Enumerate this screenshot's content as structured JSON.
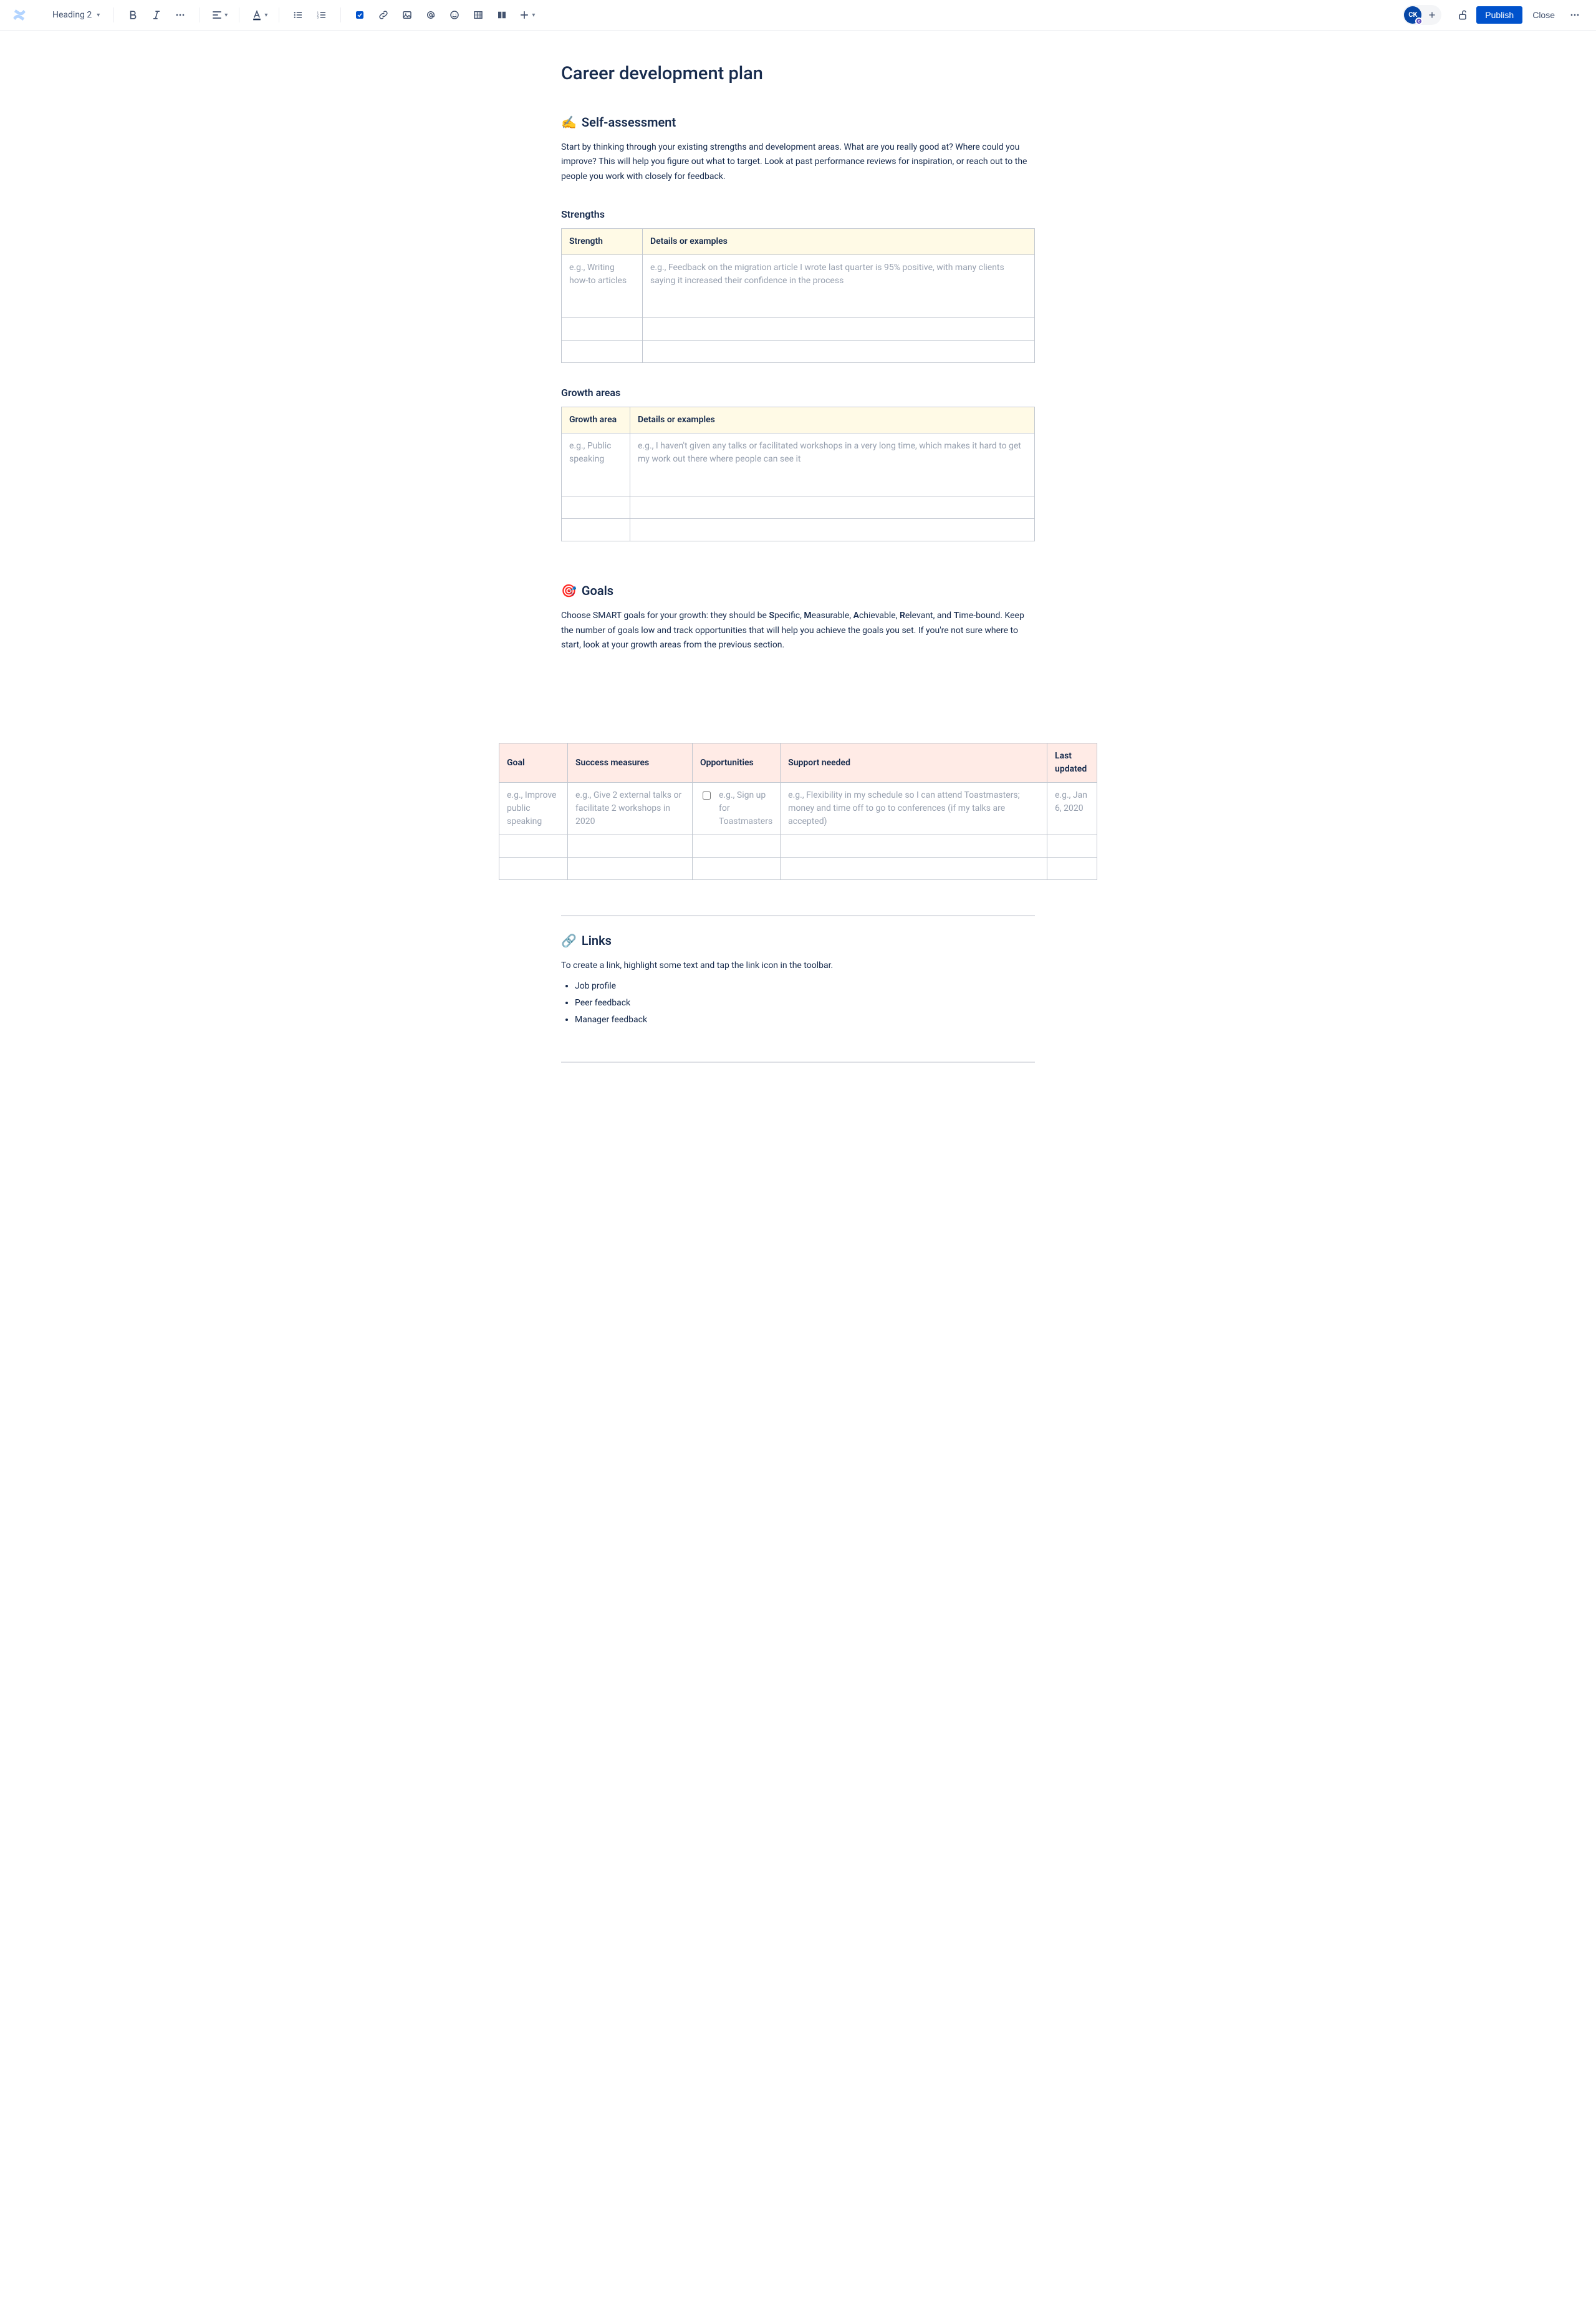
{
  "toolbar": {
    "heading_select": "Heading 2",
    "publish": "Publish",
    "close": "Close",
    "avatar_initials": "CK"
  },
  "page": {
    "title": "Career development plan",
    "self_assessment": {
      "emoji": "✍️",
      "heading": "Self-assessment",
      "intro": "Start by thinking through your existing strengths and development areas. What are you really good at? Where could you improve? This will help you figure out what to target. Look at past performance reviews for inspiration, or reach out to the people you work with closely for feedback."
    },
    "strengths": {
      "heading": "Strengths",
      "cols": [
        "Strength",
        "Details or examples"
      ],
      "rows": [
        [
          "e.g., Writing how-to articles",
          "e.g., Feedback on the migration article I wrote last quarter is 95% positive, with many clients saying it increased their confidence in the process"
        ],
        [
          "",
          ""
        ],
        [
          "",
          ""
        ]
      ]
    },
    "growth": {
      "heading": "Growth areas",
      "cols": [
        "Growth area",
        "Details or examples"
      ],
      "rows": [
        [
          "e.g., Public speaking",
          "e.g., I haven't given any talks or facilitated workshops in a very long time, which makes it hard to get my work out there where people can see it"
        ],
        [
          "",
          ""
        ],
        [
          "",
          ""
        ]
      ]
    },
    "goals": {
      "emoji": "🎯",
      "heading": "Goals",
      "intro_parts": {
        "p1": "Choose SMART goals for your growth: they should be ",
        "s": "S",
        "s_t": "pecific, ",
        "m": "M",
        "m_t": "easurable, ",
        "a": "A",
        "a_t": "chievable, ",
        "r": "R",
        "r_t": "elevant, and ",
        "t": "T",
        "t_t": "ime-bound. Keep the number of goals low and track opportunities that will help you achieve the goals you set. If you're not sure where to start, look at your growth areas from the previous section."
      },
      "cols": [
        "Goal",
        "Success measures",
        "Opportunities",
        "Support needed",
        "Last updated"
      ],
      "rows": [
        {
          "goal": "e.g., Improve public speaking",
          "success": "e.g., Give 2 external talks or facilitate 2 workshops in 2020",
          "opps": "e.g., Sign up for Toastmasters",
          "opps_checked": false,
          "support": "e.g., Flexibility in my schedule so I can attend Toastmasters; money and time off to go to conferences (if my talks are accepted)",
          "last": "e.g., Jan 6, 2020"
        }
      ]
    },
    "links": {
      "emoji": "🔗",
      "heading": "Links",
      "intro": "To create a link, highlight some text and tap the link icon in the toolbar.",
      "items": [
        "Job profile",
        "Peer feedback",
        "Manager feedback"
      ]
    }
  }
}
